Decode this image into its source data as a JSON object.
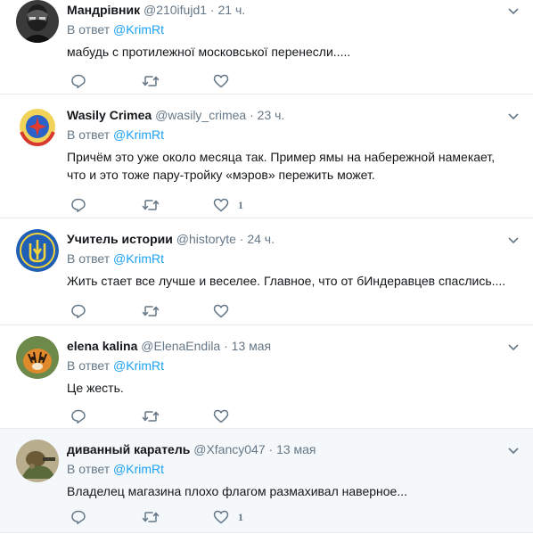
{
  "reply_prefix": "В ответ",
  "tweets": [
    {
      "name": "Мандрівник",
      "handle": "@210ifujd1",
      "separator": "·",
      "time": "21 ч.",
      "reply_to": "@KrimRt",
      "text": "мабудь с протилежної московської перенесли.....",
      "reply_count": "",
      "retweet_count": "",
      "like_count": ""
    },
    {
      "name": "Wasily Crimea",
      "handle": "@wasily_crimea",
      "separator": "·",
      "time": "23 ч.",
      "reply_to": "@KrimRt",
      "text": "Причём это уже около месяца так. Пример ямы на набережной намекает, что и это тоже пару-тройку «мэров» пережить может.",
      "reply_count": "",
      "retweet_count": "",
      "like_count": "1"
    },
    {
      "name": "Учитель истории",
      "handle": "@historyte",
      "separator": "·",
      "time": "24 ч.",
      "reply_to": "@KrimRt",
      "text": "Жить стает все лучше и веселее. Главное, что от бИндеравцев спаслись....",
      "reply_count": "",
      "retweet_count": "",
      "like_count": ""
    },
    {
      "name": "elena kalina",
      "handle": "@ElenaEndila",
      "separator": "·",
      "time": "13 мая",
      "reply_to": "@KrimRt",
      "text": "Це жесть.",
      "reply_count": "",
      "retweet_count": "",
      "like_count": ""
    },
    {
      "name": "диванный каратель",
      "handle": "@Xfancy047",
      "separator": "·",
      "time": "13 мая",
      "reply_to": "@KrimRt",
      "text": "Владелец магазина плохо флагом размахивал наверное...",
      "reply_count": "",
      "retweet_count": "",
      "like_count": "1"
    }
  ],
  "colors": {
    "accent": "#1da1f2",
    "secondary_text": "#657786",
    "divider": "#e6ecf0",
    "highlight_bg": "#f5f8fa"
  },
  "icons": {
    "reply": "reply-icon",
    "retweet": "retweet-icon",
    "like": "heart-icon",
    "more": "chevron-down-icon"
  }
}
